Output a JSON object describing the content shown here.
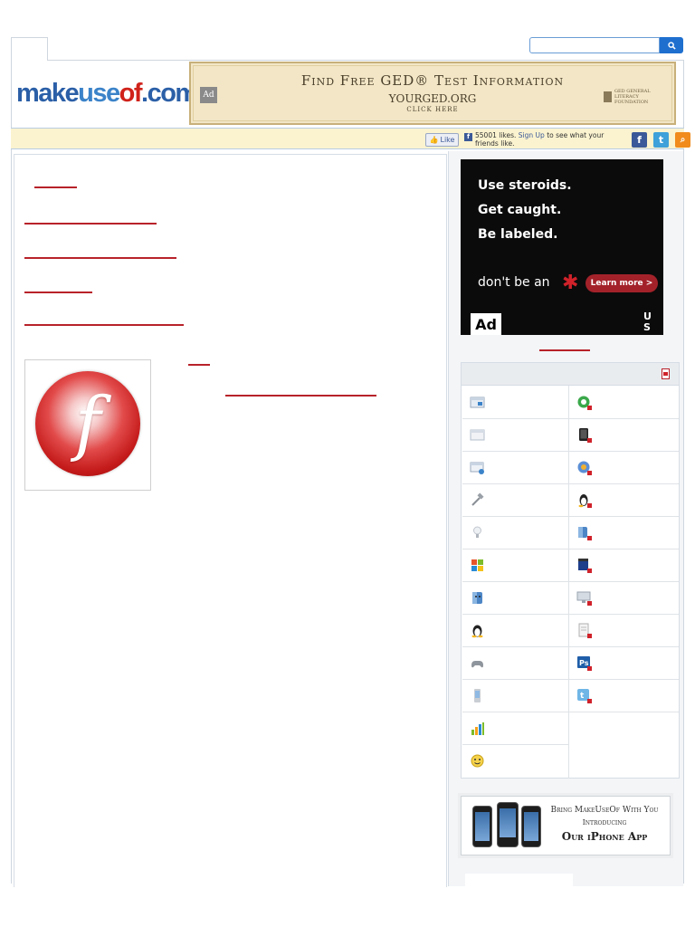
{
  "search": {
    "placeholder": "",
    "button_icon": "search-icon"
  },
  "logo": {
    "part1": "make",
    "part2": "use",
    "part3": "of",
    "part4": ".com"
  },
  "banner_ad": {
    "badge": "Ad",
    "title": "Find Free GED® Test Information",
    "site": "YOURGED.ORG",
    "cta": "CLICK HERE",
    "sponsor": "GED GENERAL LITERACY FOUNDATION"
  },
  "social": {
    "like_label": "Like",
    "likes_text": "55001 likes.",
    "signup_link": "Sign Up",
    "likes_suffix": "to see what your friends like.",
    "icons": [
      "facebook-icon",
      "twitter-icon",
      "rss-icon"
    ]
  },
  "sidebar_ad": {
    "line1": "Use steroids.",
    "line2": "Get caught.",
    "line3": "Be labeled.",
    "tagline": "don't be an",
    "button": "Learn more >",
    "badge": "Ad",
    "brand": "U S"
  },
  "categories": {
    "left_icons": [
      "browser-icon",
      "window-icon",
      "web-app-icon",
      "tools-icon",
      "lightbulb-icon",
      "windows-icon",
      "mac-icon",
      "linux-icon",
      "gamepad-icon",
      "mobile-icon",
      "chart-icon",
      "smiley-icon"
    ],
    "right_icons": [
      "refresh-icon",
      "ipad-icon",
      "itunes-icon",
      "linux-pdf-icon",
      "mac-pdf-icon",
      "video-icon",
      "monitor-icon",
      "document-icon",
      "photoshop-icon",
      "twitter-pdf-icon"
    ]
  },
  "app_promo": {
    "line1": "Bring MakeUseOf With You",
    "line2": "Introducing",
    "line3": "Our iPhone App"
  },
  "colors": {
    "link_red": "#b8222a",
    "brand_blue": "#2b5fa7",
    "brand_red": "#d0221a",
    "social_bar": "#fbf3cf"
  }
}
